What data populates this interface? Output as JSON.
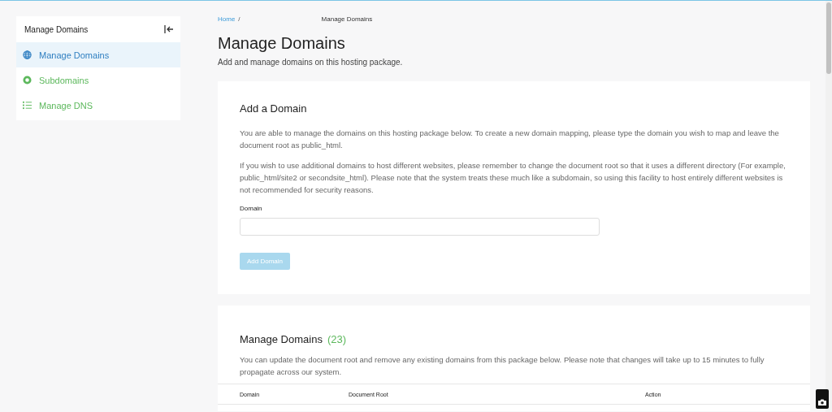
{
  "sidebar": {
    "title": "Manage Domains",
    "items": [
      {
        "label": "Manage Domains",
        "kind": "globe",
        "selected": true
      },
      {
        "label": "Subdomains",
        "kind": "circle",
        "selected": false
      },
      {
        "label": "Manage DNS",
        "kind": "list",
        "selected": false
      }
    ]
  },
  "breadcrumb": {
    "home": "Home",
    "separator": "/",
    "current": "Manage Domains"
  },
  "page": {
    "title": "Manage Domains",
    "subtitle": "Add and manage domains on this hosting package."
  },
  "add_domain": {
    "title": "Add a Domain",
    "paragraphs": [
      "You are able to manage the domains on this hosting package below. To create a new domain mapping, please type the domain you wish to map and leave the document root as public_html.",
      "If you wish to use additional domains to host different websites, please remember to change the document root so that it uses a different directory (For example, public_html/site2 or secondsite_html). Please note that the system treats these much like a subdomain, so using this facility to host entirely different websites is not recommended for security reasons."
    ],
    "field_label": "Domain",
    "button": {
      "label": "Add Domain",
      "disabled": true
    }
  },
  "manage": {
    "title": "Manage Domains",
    "count": "(23)",
    "description": "You can update the document root and remove any existing domains from this package below. Please note that changes will take up to 15 minutes to fully propagate across our system.",
    "columns": [
      "Domain",
      "Document Root",
      "Action"
    ]
  }
}
